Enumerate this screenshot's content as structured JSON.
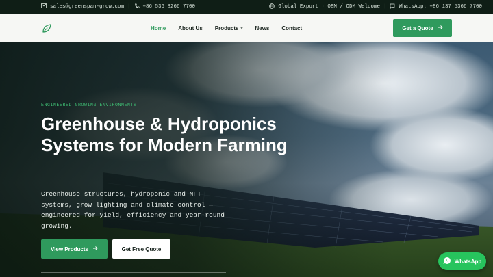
{
  "topbar": {
    "email": "sales@greenspan-grow.com",
    "phone": "+86 536 8266 7700",
    "global": "Global Export · OEM / ODM Welcome",
    "whatsapp": "WhatsApp: +86 137 5366 7700"
  },
  "nav": {
    "items": [
      "Home",
      "About Us",
      "Products",
      "News",
      "Contact"
    ],
    "active": "Home",
    "cta": "Get a Quote"
  },
  "hero": {
    "eyebrow": "ENGINEERED GROWING ENVIRONMENTS",
    "title": "Greenhouse & Hydroponics Systems for Modern Farming",
    "description": "Greenhouse structures, hydroponic and NFT systems, grow lighting and climate control — engineered for yield, efficiency and year-round growing.",
    "primary_button": "View Products",
    "secondary_button": "Get Free Quote"
  },
  "whatsapp_button": "WhatsApp",
  "colors": {
    "accent": "#2f9a5d",
    "topbar": "#0f1e16",
    "whatsapp": "#27c45d"
  },
  "icons": [
    "mail-icon",
    "phone-icon",
    "globe-icon",
    "chat-icon",
    "leaf-logo-icon",
    "arrow-right-icon",
    "whatsapp-icon"
  ]
}
